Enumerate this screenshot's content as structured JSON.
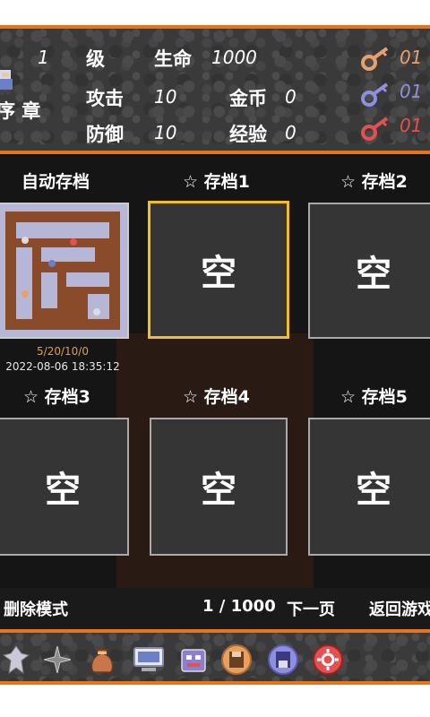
{
  "status": {
    "level_value": "1",
    "level_label": "级",
    "hp_label": "生命",
    "hp_value": "1000",
    "partial_left": "序 章",
    "atk_label": "攻击",
    "atk_value": "10",
    "gold_label": "金币",
    "gold_value": "0",
    "def_label": "防御",
    "def_value": "10",
    "exp_label": "经验",
    "exp_value": "0",
    "keys": [
      {
        "name": "yellow-key",
        "color": "#e9a06a",
        "count": "01"
      },
      {
        "name": "blue-key",
        "color": "#8f8fe0",
        "count": "01"
      },
      {
        "name": "red-key",
        "color": "#e25050",
        "count": "01"
      }
    ]
  },
  "saves": {
    "auto_title": "自动存档",
    "auto_meta1": "5/20/10/0",
    "auto_meta2": "2022-08-06 18:35:12",
    "slots": [
      {
        "title": "☆ 存档1",
        "content": "空"
      },
      {
        "title": "☆ 存档2",
        "content": "空"
      },
      {
        "title": "☆ 存档3",
        "content": "空"
      },
      {
        "title": "☆ 存档4",
        "content": "空"
      },
      {
        "title": "☆ 存档5",
        "content": "空"
      }
    ]
  },
  "footer": {
    "delete_mode": "删除模式",
    "page": "1 / 1000",
    "next": "下一页",
    "back": "返回游戏"
  },
  "toolbar": [
    "book-icon",
    "compass-icon",
    "bag-icon",
    "keyboard-icon",
    "shop-icon",
    "save-icon",
    "load-icon",
    "settings-icon"
  ],
  "colors": {
    "accent": "#e8741a",
    "selected": "#f2c020"
  }
}
